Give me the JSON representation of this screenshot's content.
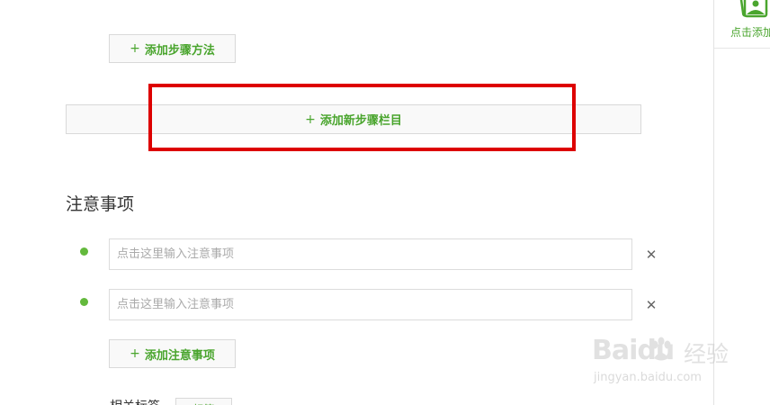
{
  "steps": {
    "add_method_label": "添加步骤方法",
    "add_section_label": "添加新步骤栏目"
  },
  "notes": {
    "title": "注意事项",
    "items": [
      {
        "placeholder": "点击这里输入注意事项",
        "value": ""
      },
      {
        "placeholder": "点击这里输入注意事项",
        "value": ""
      }
    ],
    "add_label": "添加注意事项"
  },
  "tags": {
    "label": "相关标签",
    "button_label": "标签"
  },
  "side_panel": {
    "add_image_label": "点击添加",
    "icon": "image-icon"
  },
  "watermark": {
    "brand": "Baidu",
    "product": "经验",
    "url": "jingyan.baidu.com"
  },
  "icons": {
    "plus": "+",
    "close": "✕"
  },
  "colors": {
    "accent_green": "#4aa52e",
    "bullet_green": "#63b93c",
    "highlight_red": "#dd0000"
  }
}
